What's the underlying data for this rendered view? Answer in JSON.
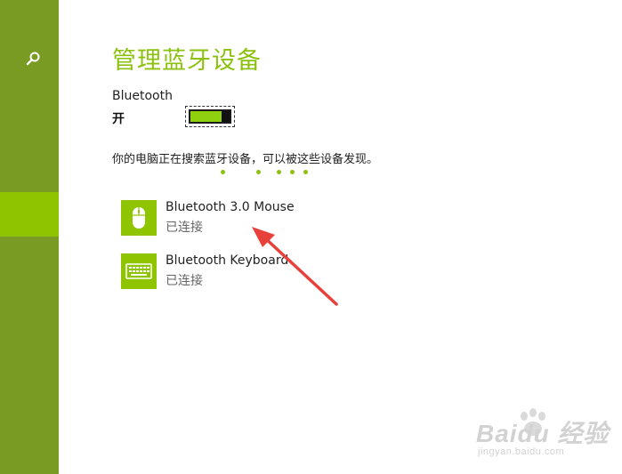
{
  "page_title": "管理蓝牙设备",
  "bluetooth": {
    "label": "Bluetooth",
    "state": "开",
    "on": true
  },
  "status_text": "你的电脑正在搜索蓝牙设备，可以被这些设备发现。",
  "devices": [
    {
      "name": "Bluetooth 3.0 Mouse",
      "status": "已连接",
      "icon": "mouse-icon"
    },
    {
      "name": "Bluetooth Keyboard",
      "status": "已连接",
      "icon": "keyboard-icon"
    }
  ],
  "watermark": {
    "logo": "Baidu 经验",
    "site": "jingyan.baidu.com"
  },
  "colors": {
    "accent": "#8cc10f",
    "sidebar": "#799b24",
    "sidebar_active": "#8fc400",
    "arrow": "#e8403a"
  }
}
